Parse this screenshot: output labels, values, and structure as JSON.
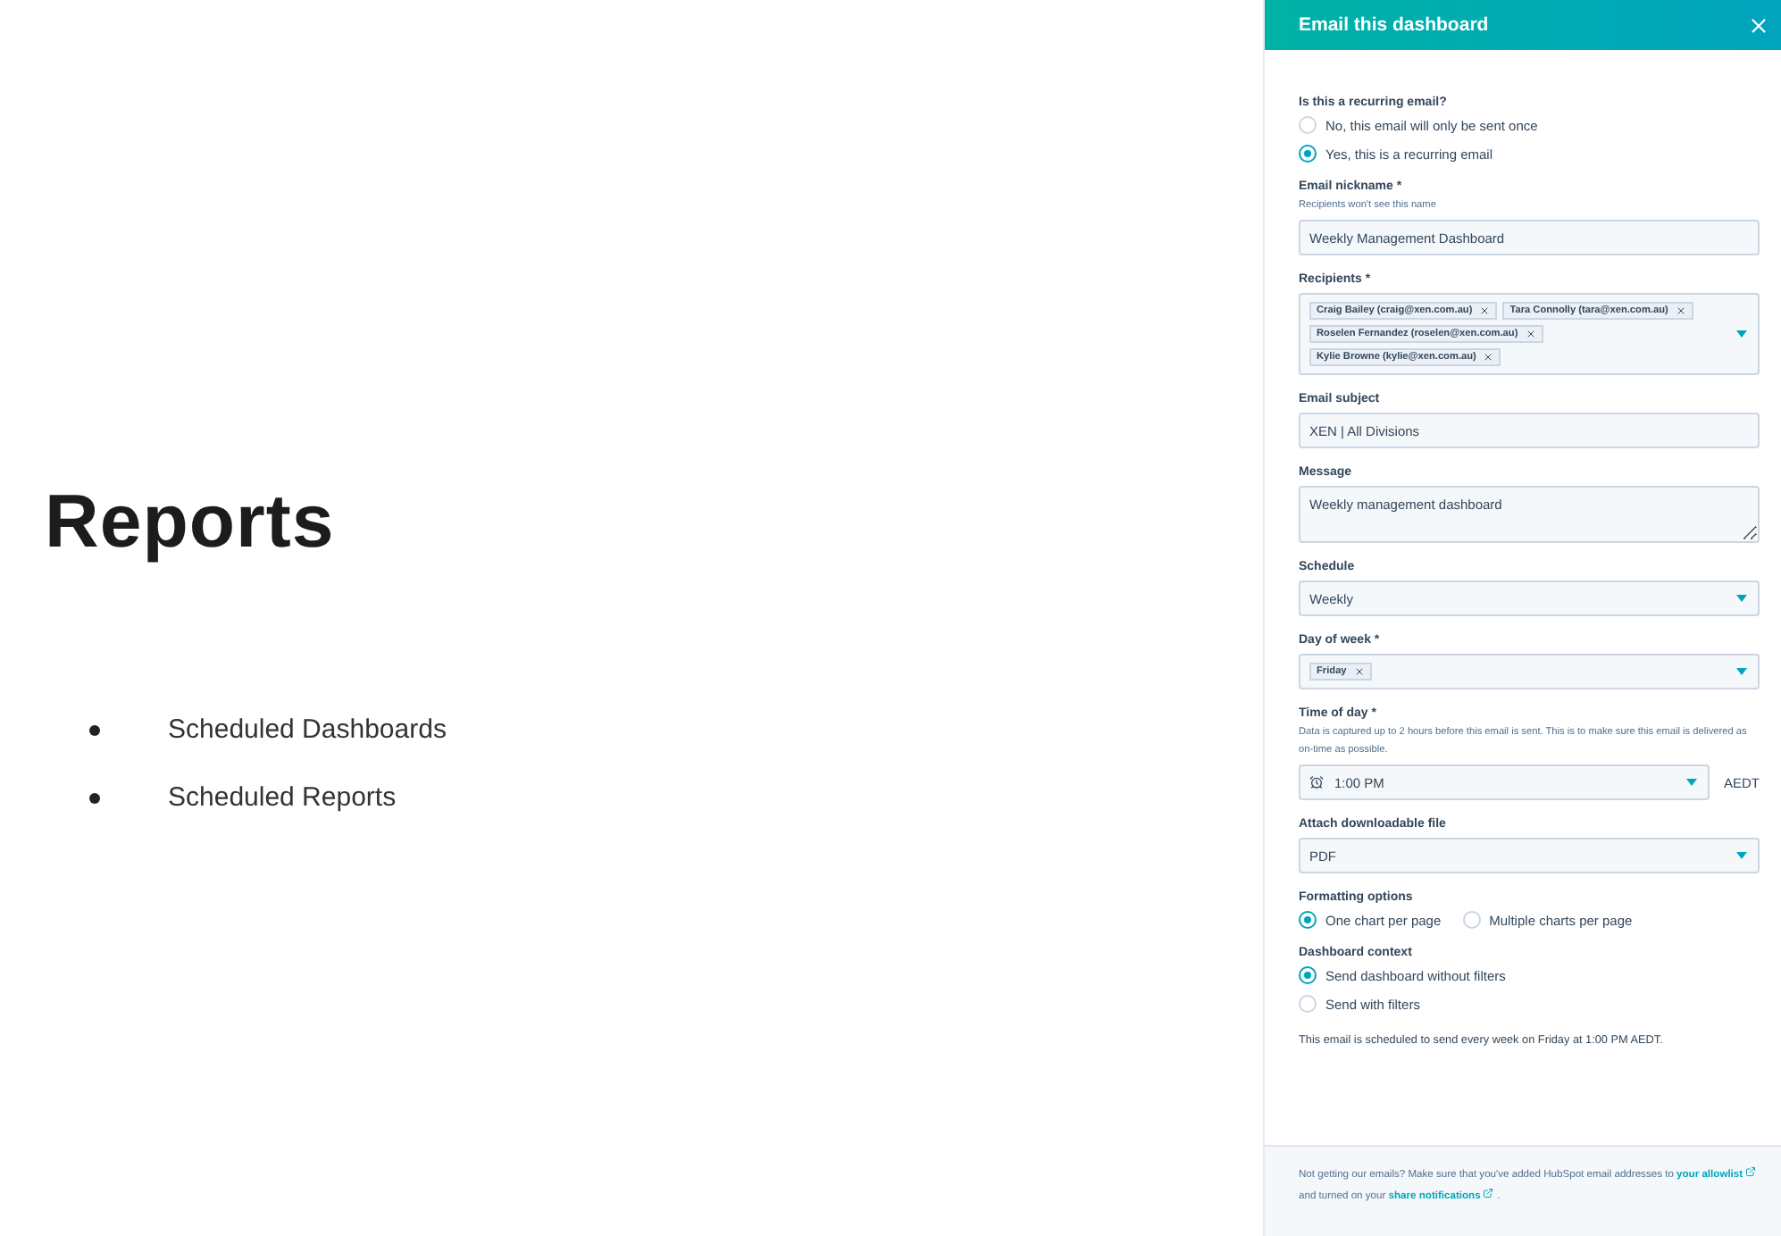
{
  "page": {
    "title": "Reports",
    "bullets": [
      "Scheduled Dashboards",
      "Scheduled Reports"
    ]
  },
  "panel": {
    "title": "Email this dashboard",
    "fields": [
      {
        "kind": "radio-group",
        "label": "Is this a recurring email?",
        "options": [
          {
            "label": "No, this email will only be sent once",
            "selected": false
          },
          {
            "label": "Yes, this is a recurring email",
            "selected": true
          }
        ]
      },
      {
        "kind": "text",
        "label": "Email nickname *",
        "hint": "Recipients won't see this name",
        "value": "Weekly Management Dashboard"
      },
      {
        "kind": "tags",
        "label": "Recipients *",
        "tags": [
          "Craig Bailey (craig@xen.com.au)",
          "Tara Connolly (tara@xen.com.au)",
          "Roselen Fernandez (roselen@xen.com.au)",
          "Kylie Browne (kylie@xen.com.au)"
        ]
      },
      {
        "kind": "text",
        "label": "Email subject",
        "value": "XEN | All Divisions"
      },
      {
        "kind": "textarea",
        "label": "Message",
        "value": "Weekly management dashboard"
      },
      {
        "kind": "select",
        "label": "Schedule",
        "value": "Weekly"
      },
      {
        "kind": "tags",
        "label": "Day of week *",
        "tags": [
          "Friday"
        ]
      },
      {
        "kind": "time",
        "label": "Time of day *",
        "hint": "Data is captured up to 2 hours before this email is sent. This is to make sure this email is delivered as on-time as possible.",
        "value": "1:00 PM",
        "suffix": "AEDT"
      },
      {
        "kind": "select",
        "label": "Attach downloadable file",
        "value": "PDF"
      },
      {
        "kind": "radio-row",
        "label": "Formatting options",
        "options": [
          {
            "label": "One chart per page",
            "selected": true
          },
          {
            "label": "Multiple charts per page",
            "selected": false
          }
        ]
      },
      {
        "kind": "radio-group",
        "label": "Dashboard context",
        "options": [
          {
            "label": "Send dashboard without filters",
            "selected": true
          },
          {
            "label": "Send with filters",
            "selected": false
          }
        ]
      }
    ],
    "summary": "This email is scheduled to send every week on Friday at 1:00 PM AEDT.",
    "footer": [
      {
        "kind": "text",
        "text": "Not getting our emails? Make sure that you've added HubSpot email addresses to "
      },
      {
        "kind": "link",
        "text": "your allowlist"
      },
      {
        "kind": "text",
        "text": " and turned on your "
      },
      {
        "kind": "link",
        "text": "share notifications"
      },
      {
        "kind": "text",
        "text": " ."
      }
    ]
  }
}
